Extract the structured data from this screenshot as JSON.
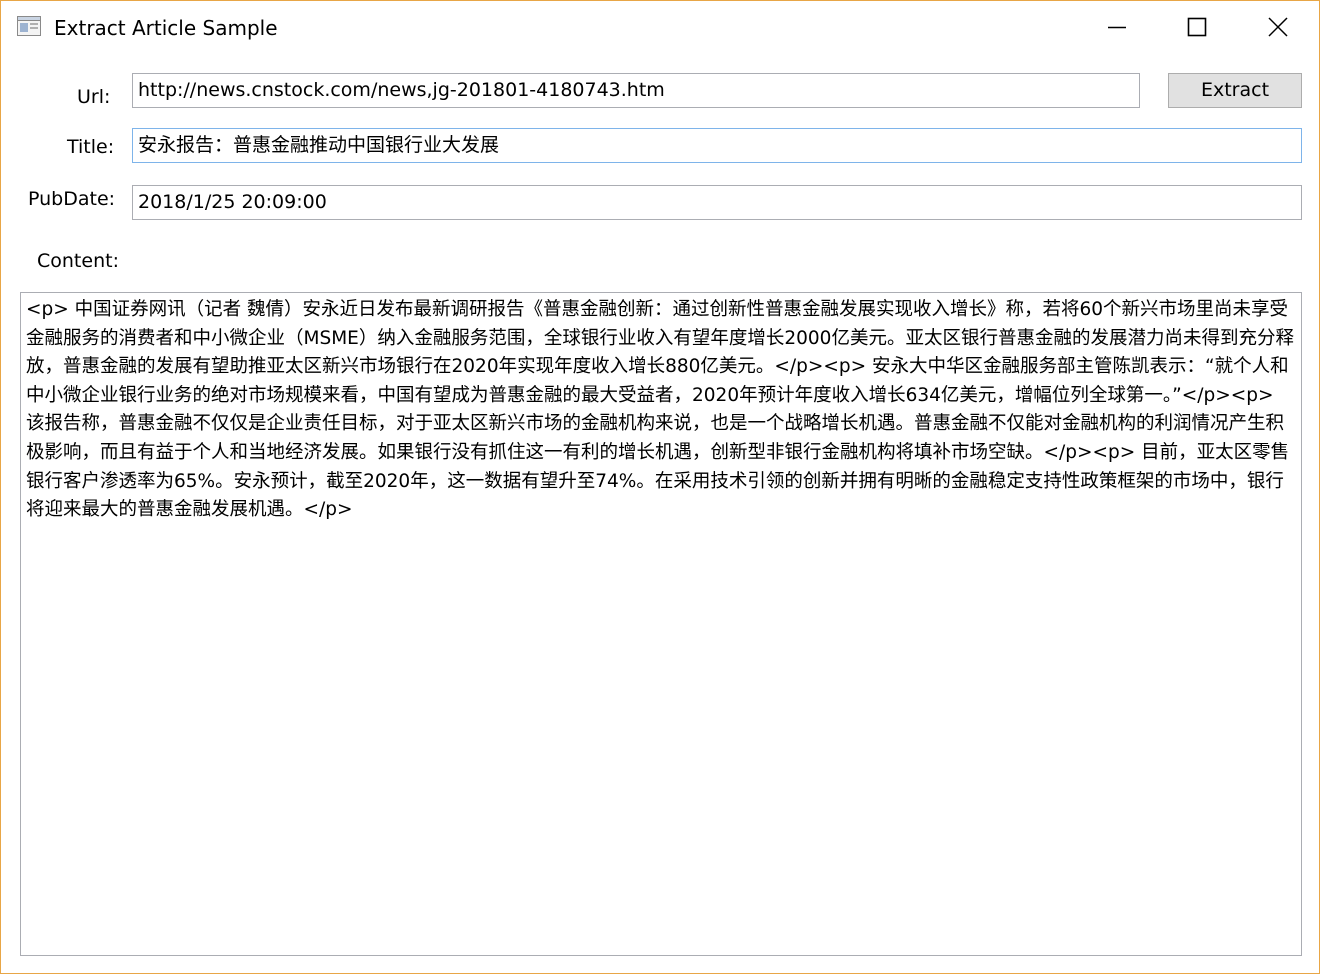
{
  "window": {
    "title": "Extract Article Sample",
    "controls": {
      "minimize": "minimize-icon",
      "maximize": "maximize-icon",
      "close": "close-icon"
    }
  },
  "form": {
    "url_label": "Url:",
    "url_value": "http://news.cnstock.com/news,jg-201801-4180743.htm",
    "extract_label": "Extract",
    "title_label": "Title:",
    "title_value": "安永报告：普惠金融推动中国银行业大发展",
    "pubdate_label": "PubDate:",
    "pubdate_value": "2018/1/25 20:09:00",
    "content_label": "Content:",
    "content_value": "<p> 中国证券网讯（记者 魏倩）安永近日发布最新调研报告《普惠金融创新：通过创新性普惠金融发展实现收入增长》称，若将60个新兴市场里尚未享受金融服务的消费者和中小微企业（MSME）纳入金融服务范围，全球银行业收入有望年度增长2000亿美元。亚太区银行普惠金融的发展潜力尚未得到充分释放，普惠金融的发展有望助推亚太区新兴市场银行在2020年实现年度收入增长880亿美元。</p><p> 安永大中华区金融服务部主管陈凯表示：“就个人和中小微企业银行业务的绝对市场规模来看，中国有望成为普惠金融的最大受益者，2020年预计年度收入增长634亿美元，增幅位列全球第一。”</p><p> 该报告称，普惠金融不仅仅是企业责任目标，对于亚太区新兴市场的金融机构来说，也是一个战略增长机遇。普惠金融不仅能对金融机构的利润情况产生积极影响，而且有益于个人和当地经济发展。如果银行没有抓住这一有利的增长机遇，创新型非银行金融机构将填补市场空缺。</p><p> 目前，亚太区零售银行客户渗透率为65%。安永预计，截至2020年，这一数据有望升至74%。在采用技术引领的创新并拥有明晰的金融稳定支持性政策框架的市场中，银行将迎来最大的普惠金融发展机遇。</p>"
  },
  "colors": {
    "window_border": "#e8a646",
    "focus_border": "#7eb4ea",
    "button_face": "#e1e1e1"
  }
}
